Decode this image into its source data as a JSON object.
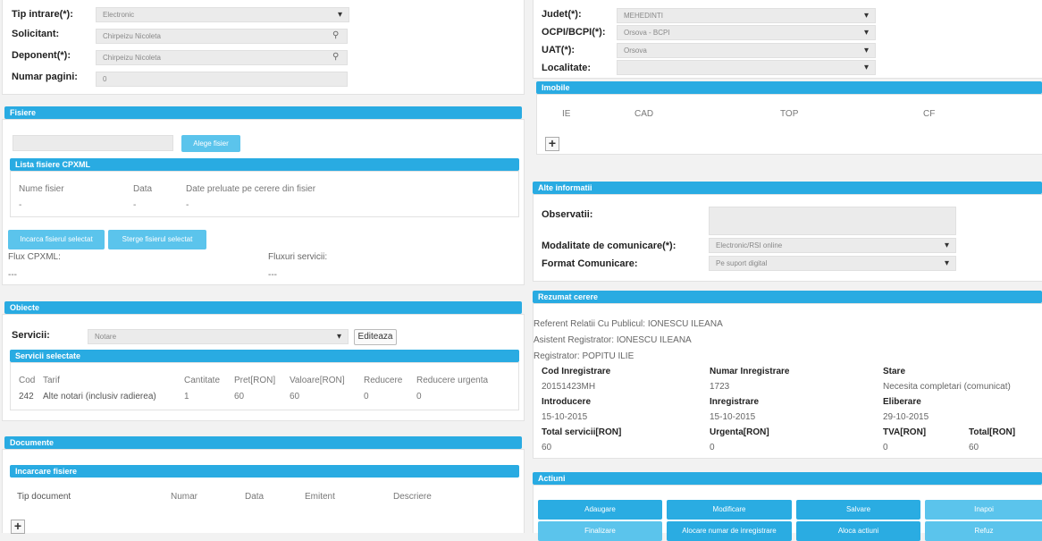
{
  "left": {
    "top_form": {
      "tip_intrare_label": "Tip intrare(*):",
      "tip_intrare_value": "Electronic",
      "solicitant_label": "Solicitant:",
      "solicitant_value": "Chirpeizu Nicoleta",
      "deponent_label": "Deponent(*):",
      "deponent_value": "Chirpeizu Nicoleta",
      "numar_pagini_label": "Numar pagini:",
      "numar_pagini_value": "0"
    },
    "fisiere": {
      "title": "Fisiere",
      "choose_button": "Alege fisier",
      "lista_title": "Lista fisiere CPXML",
      "columns": [
        "Nume fisier",
        "Data",
        "Date preluate pe cerere din fisier"
      ],
      "row": [
        "-",
        "-",
        "-"
      ],
      "load_button": "Incarca fisierul selectat",
      "delete_button": "Sterge fisierul selectat",
      "flux_cpxml_label": "Flux CPXML:",
      "fluxuri_servicii_label": "Fluxuri servicii:",
      "flux_cpxml_value": "---",
      "fluxuri_servicii_value": "---"
    },
    "obiecte": {
      "title": "Obiecte",
      "servicii_label": "Servicii:",
      "servicii_value": "Notare",
      "edit_button": "Editeaza",
      "selected_title": "Servicii selectate",
      "columns": [
        "Cod",
        "Tarif",
        "Cantitate",
        "Pret[RON]",
        "Valoare[RON]",
        "Reducere",
        "Reducere urgenta"
      ],
      "rows": [
        [
          "242",
          "Alte notari (inclusiv radierea)",
          "1",
          "60",
          "60",
          "0",
          "0"
        ]
      ]
    },
    "documente": {
      "title": "Documente",
      "incarcare_title": "Incarcare fisiere",
      "columns": [
        "Tip document",
        "Numar",
        "Data",
        "Emitent",
        "Descriere"
      ]
    }
  },
  "right": {
    "top_form": {
      "judet_label": "Judet(*):",
      "judet_value": "MEHEDINTI",
      "ocpi_label": "OCPI/BCPI(*):",
      "ocpi_value": "Orsova - BCPI",
      "uat_label": "UAT(*):",
      "uat_value": "Orsova",
      "localitate_label": "Localitate:",
      "localitate_value": ""
    },
    "imobile": {
      "title": "Imobile",
      "columns": [
        "IE",
        "CAD",
        "TOP",
        "CF"
      ]
    },
    "alte_informatii": {
      "title": "Alte informatii",
      "observatii_label": "Observatii:",
      "modalitate_label": "Modalitate de comunicare(*):",
      "modalitate_value": "Electronic/RSI online",
      "format_label": "Format Comunicare:",
      "format_value": "Pe suport digital"
    },
    "rezumat": {
      "title": "Rezumat cerere",
      "referent": "Referent Relatii Cu Publicul: IONESCU ILEANA",
      "asistent": "Asistent Registrator: IONESCU ILEANA",
      "registrator": "Registrator: POPITU ILIE",
      "cod_inregistrare_label": "Cod Inregistrare",
      "cod_inregistrare_value": "20151423MH",
      "numar_inregistrare_label": "Numar Inregistrare",
      "numar_inregistrare_value": "1723",
      "stare_label": "Stare",
      "stare_value": "Necesita completari (comunicat)",
      "introducere_label": "Introducere",
      "introducere_value": "15-10-2015",
      "inregistrare_label": "Inregistrare",
      "inregistrare_value": "15-10-2015",
      "eliberare_label": "Eliberare",
      "eliberare_value": "29-10-2015",
      "total_servicii_label": "Total servicii[RON]",
      "total_servicii_value": "60",
      "urgenta_label": "Urgenta[RON]",
      "urgenta_value": "0",
      "tva_label": "TVA[RON]",
      "tva_value": "0",
      "total_label": "Total[RON]",
      "total_value": "60"
    },
    "actiuni": {
      "title": "Actiuni",
      "row1": [
        "Adaugare",
        "Modificare",
        "Salvare",
        "Inapoi"
      ],
      "row2": [
        "Finalizare",
        "Alocare numar de inregistrare",
        "Aloca actiuni",
        "Refuz"
      ]
    }
  },
  "colors": {
    "accent": "#29abe2",
    "button": "#5bc4ec"
  }
}
